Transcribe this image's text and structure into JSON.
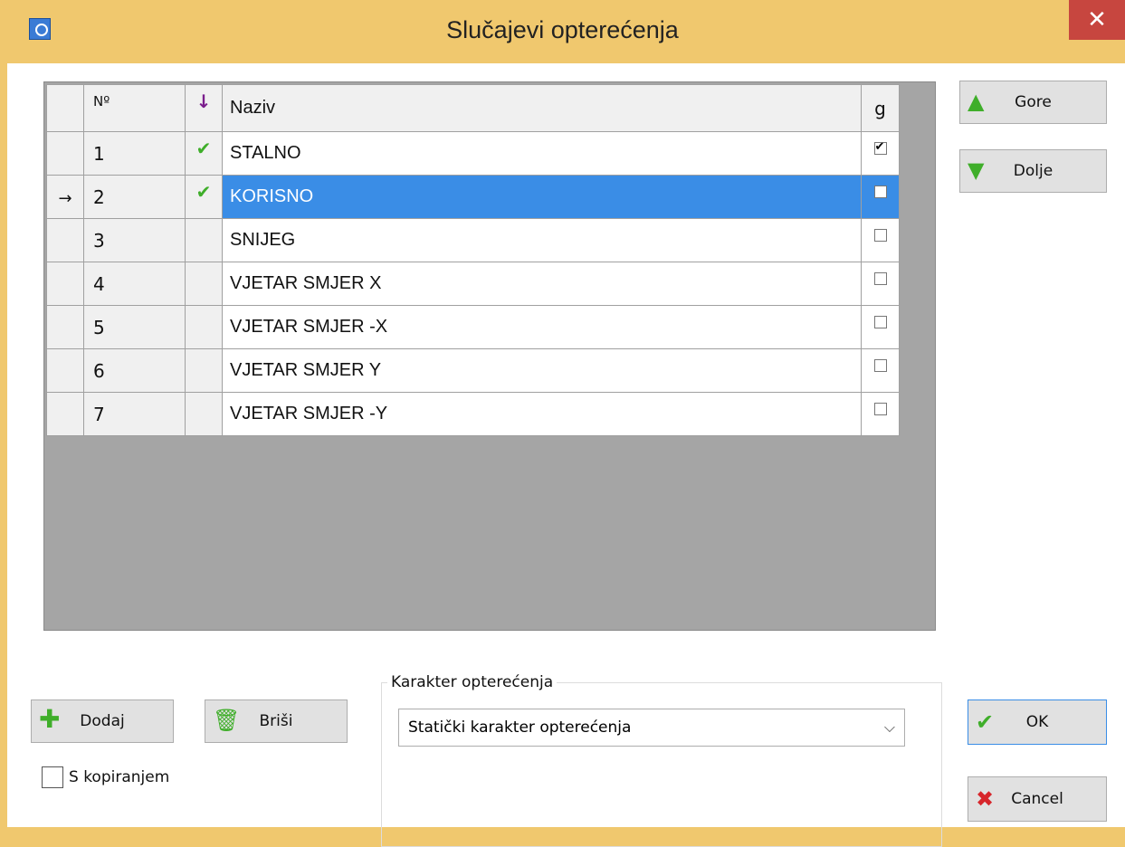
{
  "window": {
    "title": "Slučajevi opterećenja",
    "close_glyph": "✕"
  },
  "grid": {
    "headers": {
      "no": "Nº",
      "flag_glyph": "↓",
      "name": "Naziv",
      "g": "g"
    },
    "rows": [
      {
        "no": "1",
        "name": "STALNO",
        "checked": true,
        "g": true,
        "selected": false,
        "current": false
      },
      {
        "no": "2",
        "name": "KORISNO",
        "checked": true,
        "g": false,
        "selected": true,
        "current": true
      },
      {
        "no": "3",
        "name": "SNIJEG",
        "checked": false,
        "g": false,
        "selected": false,
        "current": false
      },
      {
        "no": "4",
        "name": "VJETAR SMJER X",
        "checked": false,
        "g": false,
        "selected": false,
        "current": false
      },
      {
        "no": "5",
        "name": "VJETAR SMJER -X",
        "checked": false,
        "g": false,
        "selected": false,
        "current": false
      },
      {
        "no": "6",
        "name": "VJETAR SMJER Y",
        "checked": false,
        "g": false,
        "selected": false,
        "current": false
      },
      {
        "no": "7",
        "name": "VJETAR SMJER -Y",
        "checked": false,
        "g": false,
        "selected": false,
        "current": false
      }
    ],
    "current_row_glyph": "→",
    "check_glyph": "✔"
  },
  "buttons": {
    "up": "Gore",
    "down": "Dolje",
    "add": "Dodaj",
    "delete": "Briši",
    "ok": "OK",
    "cancel": "Cancel"
  },
  "copy_option": {
    "label": "S kopiranjem",
    "checked": false
  },
  "load_character": {
    "group_label": "Karakter opterećenja",
    "selected": "Statički karakter opterećenja"
  },
  "colors": {
    "selection": "#3a8de6",
    "accent_green": "#3fae2a",
    "accent_red": "#d7262b",
    "titlebar": "#f0c86e",
    "close": "#c7463f"
  }
}
